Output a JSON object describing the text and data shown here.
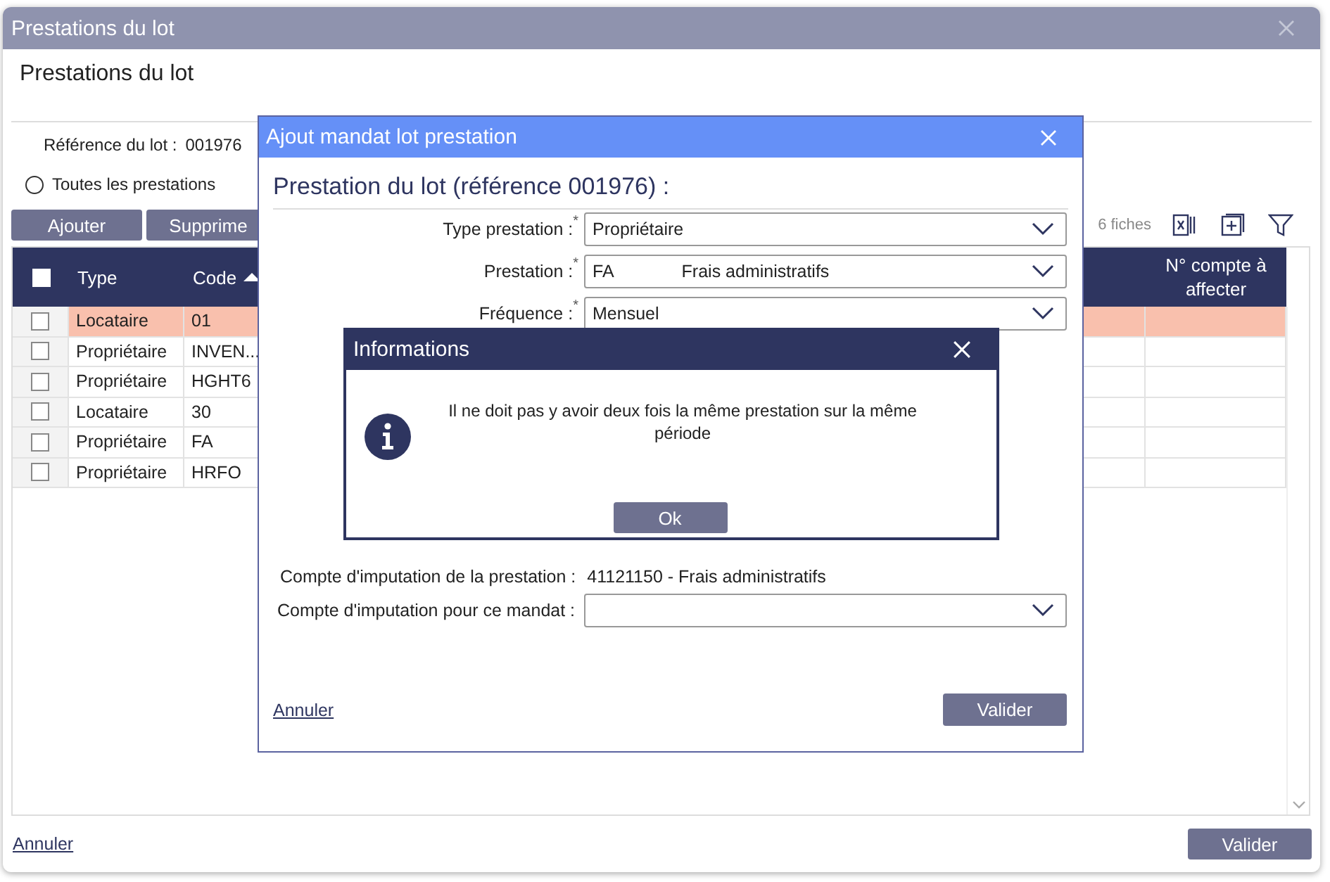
{
  "window": {
    "title": "Prestations du lot",
    "heading": "Prestations du lot"
  },
  "reference": {
    "label": "Référence du lot :",
    "value": "001976"
  },
  "filter_radios": [
    {
      "label": "Toutes les prestations",
      "selected": false
    }
  ],
  "toolbar": {
    "buttons": [
      "Ajouter",
      "Supprime"
    ],
    "count": "6 fiches"
  },
  "table": {
    "header_checked": false,
    "columns": [
      {
        "label": "Type",
        "sorted_ascending": false
      },
      {
        "label": "Code",
        "sorted_ascending": true
      },
      {
        "label": "N° compte à affecter",
        "sorted_ascending": false
      }
    ],
    "rows": [
      {
        "type": "Locataire",
        "code": "01",
        "selected": true,
        "checked": false
      },
      {
        "type": "Propriétaire",
        "code": "INVEN...",
        "selected": false,
        "checked": false
      },
      {
        "type": "Propriétaire",
        "code": "HGHT6",
        "selected": false,
        "checked": false
      },
      {
        "type": "Locataire",
        "code": "30",
        "selected": false,
        "checked": false
      },
      {
        "type": "Propriétaire",
        "code": "FA",
        "selected": false,
        "checked": false
      },
      {
        "type": "Propriétaire",
        "code": "HRFO",
        "selected": false,
        "checked": false
      }
    ]
  },
  "footer": {
    "cancel": "Annuler",
    "confirm": "Valider"
  },
  "dialog": {
    "title": "Ajout mandat lot prestation",
    "heading": "Prestation du lot (référence 001976) :",
    "fields": [
      {
        "label": "Type prestation :",
        "required_mark": "*",
        "value": "Propriétaire"
      },
      {
        "label": "Prestation :",
        "required_mark": "*",
        "value": "FA",
        "detail": "Frais administratifs"
      },
      {
        "label": "Fréquence :",
        "required_mark": "*",
        "value": "Mensuel"
      }
    ],
    "account": {
      "label": "Compte d'imputation de la prestation :",
      "value": "41121150 - Frais administratifs"
    },
    "mandate_account": {
      "label": "Compte d'imputation pour ce mandat :"
    },
    "cancel": "Annuler",
    "confirm": "Valider"
  },
  "alert": {
    "title": "Informations",
    "message": "Il ne doit pas y avoir deux fois la même prestation sur la même période",
    "button": "Ok"
  }
}
